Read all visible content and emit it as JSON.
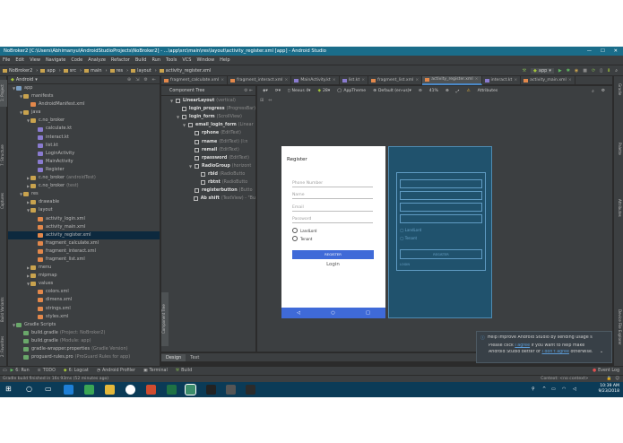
{
  "window": {
    "title": "NoBroker2 [C:\\Users\\Abhimanyu\\AndroidStudioProjects\\NoBroker2] - ...\\app\\src\\main\\res\\layout\\activity_register.xml [app] - Android Studio"
  },
  "menu": [
    "File",
    "Edit",
    "View",
    "Navigate",
    "Code",
    "Analyze",
    "Refactor",
    "Build",
    "Run",
    "Tools",
    "VCS",
    "Window",
    "Help"
  ],
  "breadcrumbs": [
    "NoBroker2",
    "app",
    "src",
    "main",
    "res",
    "layout",
    "activity_register.xml"
  ],
  "run_config": "app",
  "project_panel": {
    "selector": "Android",
    "tree": [
      {
        "label": "app",
        "depth": 0,
        "arrow": "▼",
        "kind": "module"
      },
      {
        "label": "manifests",
        "depth": 1,
        "arrow": "▼",
        "kind": "folder"
      },
      {
        "label": "AndroidManifest.xml",
        "depth": 2,
        "arrow": "",
        "kind": "xml"
      },
      {
        "label": "java",
        "depth": 1,
        "arrow": "▼",
        "kind": "folder"
      },
      {
        "label": "c.no_broker",
        "depth": 2,
        "arrow": "▼",
        "kind": "package"
      },
      {
        "label": "calculate.kt",
        "depth": 3,
        "arrow": "",
        "kind": "kt"
      },
      {
        "label": "interact.kt",
        "depth": 3,
        "arrow": "",
        "kind": "kt"
      },
      {
        "label": "list.kt",
        "depth": 3,
        "arrow": "",
        "kind": "kt"
      },
      {
        "label": "LoginActivity",
        "depth": 3,
        "arrow": "",
        "kind": "kt"
      },
      {
        "label": "MainActivity",
        "depth": 3,
        "arrow": "",
        "kind": "kt"
      },
      {
        "label": "Register",
        "depth": 3,
        "arrow": "",
        "kind": "kt"
      },
      {
        "label": "c.no_broker",
        "suffix": "(androidTest)",
        "depth": 2,
        "arrow": "▶",
        "kind": "package"
      },
      {
        "label": "c.no_broker",
        "suffix": "(test)",
        "depth": 2,
        "arrow": "▶",
        "kind": "package"
      },
      {
        "label": "res",
        "depth": 1,
        "arrow": "▼",
        "kind": "folder"
      },
      {
        "label": "drawable",
        "depth": 2,
        "arrow": "▶",
        "kind": "folder"
      },
      {
        "label": "layout",
        "depth": 2,
        "arrow": "▼",
        "kind": "folder"
      },
      {
        "label": "activity_login.xml",
        "depth": 3,
        "arrow": "",
        "kind": "xml"
      },
      {
        "label": "activity_main.xml",
        "depth": 3,
        "arrow": "",
        "kind": "xml"
      },
      {
        "label": "activity_register.xml",
        "depth": 3,
        "arrow": "",
        "kind": "xml",
        "selected": true
      },
      {
        "label": "fragment_calculate.xml",
        "depth": 3,
        "arrow": "",
        "kind": "xml"
      },
      {
        "label": "fragment_interact.xml",
        "depth": 3,
        "arrow": "",
        "kind": "xml"
      },
      {
        "label": "fragment_list.xml",
        "depth": 3,
        "arrow": "",
        "kind": "xml"
      },
      {
        "label": "menu",
        "depth": 2,
        "arrow": "▶",
        "kind": "folder"
      },
      {
        "label": "mipmap",
        "depth": 2,
        "arrow": "▶",
        "kind": "folder"
      },
      {
        "label": "values",
        "depth": 2,
        "arrow": "▼",
        "kind": "folder"
      },
      {
        "label": "colors.xml",
        "depth": 3,
        "arrow": "",
        "kind": "xml"
      },
      {
        "label": "dimens.xml",
        "depth": 3,
        "arrow": "",
        "kind": "xml"
      },
      {
        "label": "strings.xml",
        "depth": 3,
        "arrow": "",
        "kind": "xml"
      },
      {
        "label": "styles.xml",
        "depth": 3,
        "arrow": "",
        "kind": "xml"
      },
      {
        "label": "Gradle Scripts",
        "depth": 0,
        "arrow": "▼",
        "kind": "gradle"
      },
      {
        "label": "build.gradle",
        "suffix": "(Project: NoBroker2)",
        "depth": 1,
        "arrow": "",
        "kind": "gradle"
      },
      {
        "label": "build.gradle",
        "suffix": "(Module: app)",
        "depth": 1,
        "arrow": "",
        "kind": "gradle"
      },
      {
        "label": "gradle-wrapper.properties",
        "suffix": "(Gradle Version)",
        "depth": 1,
        "arrow": "",
        "kind": "gradle"
      },
      {
        "label": "proguard-rules.pro",
        "suffix": "(ProGuard Rules for app)",
        "depth": 1,
        "arrow": "",
        "kind": "gradle"
      }
    ]
  },
  "editor_tabs": [
    {
      "label": "fragment_calculate.xml",
      "active": false
    },
    {
      "label": "fragment_interact.xml",
      "active": false
    },
    {
      "label": "MainActivity.kt",
      "active": false
    },
    {
      "label": "list.kt",
      "active": false
    },
    {
      "label": "fragment_list.xml",
      "active": false
    },
    {
      "label": "activity_register.xml",
      "active": true
    },
    {
      "label": "interact.kt",
      "active": false
    },
    {
      "label": "activity_main.xml",
      "active": false
    }
  ],
  "design_toolbar": {
    "device": "Nexus 4",
    "api": "28",
    "theme": "AppTheme",
    "locale": "Default (en-us)",
    "zoom": "41%",
    "panel": "Attributes"
  },
  "component_tree": {
    "title": "Component Tree",
    "nodes": [
      {
        "name": "LinearLayout",
        "detail": "(vertical)",
        "depth": 0,
        "arrow": "▼"
      },
      {
        "name": "login_progress",
        "detail": "(ProgressBar)",
        "depth": 1,
        "arrow": ""
      },
      {
        "name": "login_form",
        "detail": "(ScrollView)",
        "depth": 1,
        "arrow": "▼"
      },
      {
        "name": "email_login_form",
        "detail": "(Linear",
        "depth": 2,
        "arrow": "▼"
      },
      {
        "name": "rphone",
        "detail": "(EditText)",
        "depth": 3,
        "arrow": ""
      },
      {
        "name": "rname",
        "detail": "(EditText) (l:n",
        "depth": 3,
        "arrow": ""
      },
      {
        "name": "remail",
        "detail": "(EditText)",
        "depth": 3,
        "arrow": ""
      },
      {
        "name": "rpassword",
        "detail": "(EditText)",
        "depth": 3,
        "arrow": ""
      },
      {
        "name": "RadioGroup",
        "detail": "(horizont",
        "depth": 3,
        "arrow": "▼"
      },
      {
        "name": "rbld",
        "detail": "(RadioButto",
        "depth": 4,
        "arrow": ""
      },
      {
        "name": "rbtnt",
        "detail": "(RadioButto",
        "depth": 4,
        "arrow": ""
      },
      {
        "name": "registerbutton",
        "detail": "(Butto",
        "depth": 3,
        "arrow": ""
      },
      {
        "name": "Ab shift",
        "detail": "(TextView) - \"Bu",
        "depth": 3,
        "arrow": ""
      }
    ]
  },
  "phone_preview": {
    "title": "Register",
    "fields": [
      "Phone Number",
      "Name",
      "Email",
      "Password"
    ],
    "radios": [
      "LandLord",
      "Tenant"
    ],
    "register_button": "REGISTER",
    "login_text": "Login"
  },
  "blueprint": {
    "radios": [
      "LandLord",
      "Tenant"
    ],
    "button": "REGISTER",
    "footer": "LOGIN"
  },
  "bottom_tabs": [
    "Design",
    "Text"
  ],
  "tool_windows": [
    "6: Run",
    "TODO",
    "6: Logcat",
    "Android Profiler",
    "Terminal",
    "Build"
  ],
  "event_log": "Event Log",
  "status": "Gradle build finished in 16s 93ms (52 minutes ago)",
  "status_right": "Context: <no context>",
  "notification": {
    "title": "Help improve Android Studio by sending usage s",
    "line1_pre": "Please click ",
    "line1_link": "I agree",
    "line1_post": " if you want to help make",
    "line2_pre": "Android Studio better or ",
    "line2_link": "I don't agree",
    "line2_post": " otherwise."
  },
  "side_tabs_left": [
    "1: Project",
    "7: Structure",
    "Captures",
    "Build Variants",
    "2: Favorites"
  ],
  "side_tabs_right": [
    "Gradle",
    "Palette",
    "Attributes",
    "Device File Explorer"
  ],
  "component_tree_vtab": "Component Tree",
  "taskbar": {
    "time": "10:39 AM",
    "date": "9/23/2018"
  }
}
